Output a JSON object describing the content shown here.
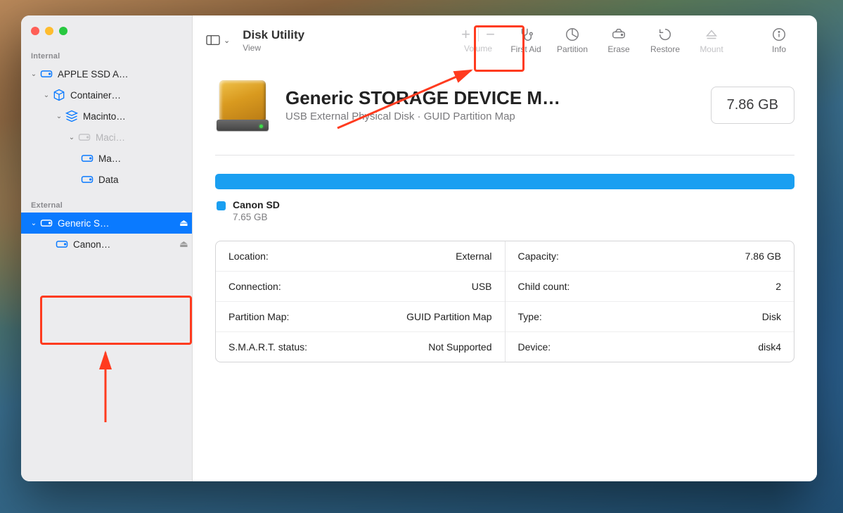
{
  "app": {
    "title": "Disk Utility"
  },
  "toolbar": {
    "view_label": "View",
    "volume_label": "Volume",
    "first_aid": "First Aid",
    "partition": "Partition",
    "erase": "Erase",
    "restore": "Restore",
    "mount": "Mount",
    "info": "Info"
  },
  "sidebar": {
    "sections": {
      "internal": "Internal",
      "external": "External"
    },
    "items": [
      {
        "label": "APPLE SSD A…"
      },
      {
        "label": "Container…"
      },
      {
        "label": "Macinto…"
      },
      {
        "label": "Maci…"
      },
      {
        "label": "Ma…"
      },
      {
        "label": "Data"
      },
      {
        "label": "Generic S…"
      },
      {
        "label": "Canon…"
      }
    ]
  },
  "disk": {
    "title": "Generic STORAGE DEVICE M…",
    "subtitle": "USB External Physical Disk · GUID Partition Map",
    "capacity_badge": "7.86 GB"
  },
  "legend": {
    "name": "Canon SD",
    "size": "7.65 GB"
  },
  "info": {
    "left": [
      {
        "k": "Location:",
        "v": "External"
      },
      {
        "k": "Connection:",
        "v": "USB"
      },
      {
        "k": "Partition Map:",
        "v": "GUID Partition Map"
      },
      {
        "k": "S.M.A.R.T. status:",
        "v": "Not Supported"
      }
    ],
    "right": [
      {
        "k": "Capacity:",
        "v": "7.86 GB"
      },
      {
        "k": "Child count:",
        "v": "2"
      },
      {
        "k": "Type:",
        "v": "Disk"
      },
      {
        "k": "Device:",
        "v": "disk4"
      }
    ]
  },
  "colors": {
    "accent": "#0a7aff",
    "bar": "#1a9ff1",
    "highlight": "#ff3b1f"
  }
}
